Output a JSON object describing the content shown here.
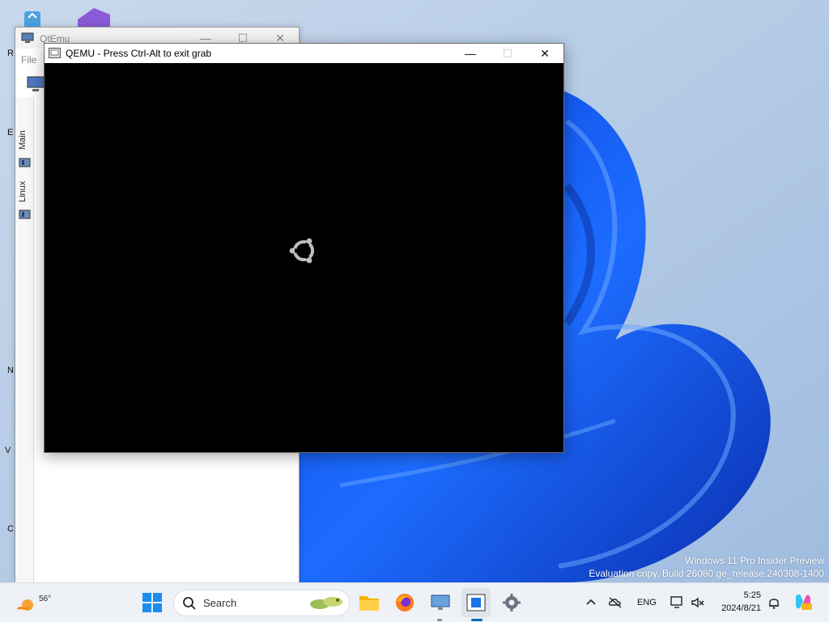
{
  "desktop": {
    "icon_label_fragments": [
      "R",
      "E",
      "N",
      "V",
      "C"
    ],
    "watermark": {
      "line1": "Windows 11 Pro Insider Preview",
      "line2": "Evaluation copy. Build 26080.ge_release.240308-1400"
    }
  },
  "qtemu_window": {
    "title": "QtEmu",
    "menu": [
      "File"
    ],
    "tabs": [
      "Main",
      "Linux"
    ],
    "controls": {
      "minimize": "—",
      "maximize": "☐",
      "close": "✕"
    }
  },
  "qemu_window": {
    "title": "QEMU - Press Ctrl-Alt to exit grab",
    "controls": {
      "minimize": "—",
      "maximize": "☐",
      "close": "✕"
    },
    "boot_logo": "ubuntu-logo-icon"
  },
  "taskbar": {
    "weather": {
      "temp": "56°",
      "icon": "weather-icon"
    },
    "search": {
      "placeholder": "Search"
    },
    "pinned": [
      {
        "name": "start",
        "icon": "windows-logo-icon"
      },
      {
        "name": "file-explorer",
        "icon": "folder-icon"
      },
      {
        "name": "firefox",
        "icon": "firefox-icon"
      },
      {
        "name": "remote-desktop",
        "icon": "monitor-icon"
      },
      {
        "name": "qemu-window",
        "icon": "qemu-app-icon",
        "active": true
      },
      {
        "name": "settings",
        "icon": "gear-icon"
      }
    ],
    "tray": {
      "language": "ENG",
      "time": "5:25",
      "date": "2024/8/21"
    }
  },
  "colors": {
    "taskbar": "#eef1f6",
    "accent": "#0067c0",
    "qemu_screen": "#000000",
    "wallpaper_bg": "#a9c4e2"
  }
}
